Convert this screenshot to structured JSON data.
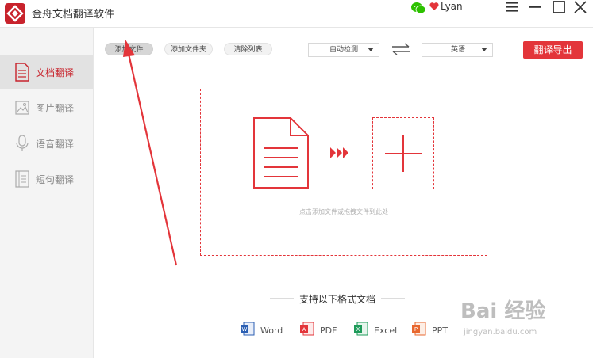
{
  "app": {
    "title": "金舟文档翻译软件",
    "username": "Lyan",
    "brand_color": "#c8232c",
    "accent_color": "#e3353a"
  },
  "window_controls": {
    "icons": [
      "menu-icon",
      "minimize-icon",
      "maximize-icon",
      "close-icon"
    ]
  },
  "sidebar": {
    "items": [
      {
        "label": "文档翻译",
        "icon": "document-icon",
        "active": true
      },
      {
        "label": "图片翻译",
        "icon": "image-icon",
        "active": false
      },
      {
        "label": "语音翻译",
        "icon": "microphone-icon",
        "active": false
      },
      {
        "label": "短句翻译",
        "icon": "text-icon",
        "active": false
      }
    ]
  },
  "toolbar": {
    "add_file": "添加文件",
    "add_folder": "添加文件夹",
    "clear_list": "清除列表",
    "source_lang": "自动检测",
    "target_lang": "英语",
    "export": "翻译导出"
  },
  "dropzone": {
    "hint": "点击添加文件或拖拽文件到此处"
  },
  "formats": {
    "title": "支持以下格式文档",
    "items": [
      {
        "label": "Word",
        "icon": "word-icon",
        "color": "#2b5fb3"
      },
      {
        "label": "PDF",
        "icon": "pdf-icon",
        "color": "#e3353a"
      },
      {
        "label": "Excel",
        "icon": "excel-icon",
        "color": "#1e9b5a"
      },
      {
        "label": "PPT",
        "icon": "ppt-icon",
        "color": "#e8672e"
      }
    ]
  },
  "watermark": {
    "main": "Bai 经验",
    "sub": "jingyan.baidu.com"
  }
}
